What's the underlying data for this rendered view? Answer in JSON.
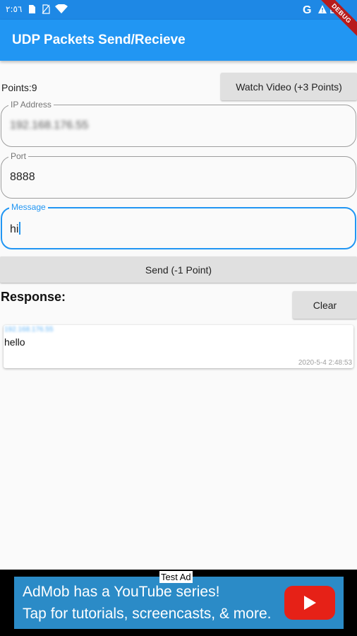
{
  "status_bar": {
    "time": "٢:٥٦",
    "icons": [
      "sim-card-icon",
      "no-sim-icon",
      "wifi-icon",
      "google-icon",
      "warning-icon",
      "image-icon"
    ]
  },
  "app_bar": {
    "title": "UDP Packets Send/Recieve",
    "debug_banner": "DEBUG",
    "color": "#2196f3"
  },
  "points": {
    "label": "Points:9"
  },
  "buttons": {
    "watch_video": "Watch Video (+3 Points)",
    "send": "Send (-1 Point)",
    "clear": "Clear"
  },
  "form": {
    "ip_address": {
      "label": "IP Address",
      "value": "192.168.176.55"
    },
    "port": {
      "label": "Port",
      "value": "8888"
    },
    "message": {
      "label": "Message",
      "value": "hi"
    }
  },
  "response": {
    "heading": "Response:",
    "items": [
      {
        "sender": "192.168.176.55",
        "message": "hello",
        "timestamp": "2020-5-4 2:48:53"
      }
    ]
  },
  "ad": {
    "tag": "Test Ad",
    "line1": "AdMob has a YouTube series!",
    "line2": "Tap for tutorials, screencasts, & more.",
    "icon": "youtube-play-icon",
    "background_color": "#2b8bc7"
  }
}
